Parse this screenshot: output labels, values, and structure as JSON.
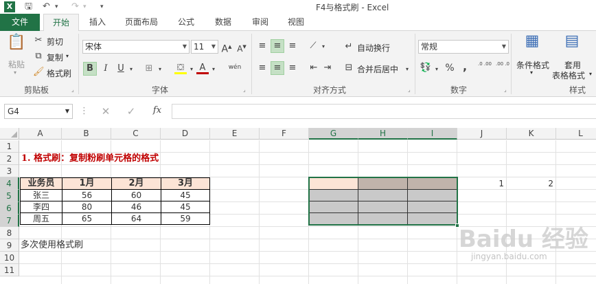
{
  "app": {
    "window_title": "F4与格式刷 - Excel",
    "logo_letter": "X"
  },
  "tabs": [
    "文件",
    "开始",
    "插入",
    "页面布局",
    "公式",
    "数据",
    "审阅",
    "视图"
  ],
  "ribbon": {
    "clipboard": {
      "paste": "粘贴",
      "cut": "剪切",
      "copy": "复制",
      "format_painter": "格式刷",
      "group": "剪贴板"
    },
    "font": {
      "name": "宋体",
      "size": "11",
      "bold": "B",
      "italic": "I",
      "underline": "U",
      "phonetic": "wén",
      "group": "字体"
    },
    "alignment": {
      "wrap": "自动换行",
      "merge": "合并后居中",
      "group": "对齐方式"
    },
    "number": {
      "format": "常规",
      "percent": "%",
      "comma": ",",
      "inc_dec": ".0 .00",
      "dec_dec": ".00 .0",
      "group": "数字"
    },
    "styles": {
      "conditional": "条件格式",
      "table_1": "套用",
      "table_2": "表格格式",
      "group": "样式"
    }
  },
  "formula_bar": {
    "name_box": "G4",
    "fx": "fx",
    "value": ""
  },
  "columns": [
    "A",
    "B",
    "C",
    "D",
    "E",
    "F",
    "G",
    "H",
    "I",
    "J",
    "K",
    "L"
  ],
  "rows": [
    "1",
    "2",
    "3",
    "4",
    "5",
    "6",
    "7",
    "8",
    "9",
    "10",
    "11"
  ],
  "cells": {
    "A2": "1. 格式刷：复制粉刷单元格的格式",
    "A9": "多次使用格式刷",
    "J4": "1",
    "K4": "2"
  },
  "table": {
    "headers": [
      "业务员",
      "1月",
      "2月",
      "3月"
    ],
    "rows": [
      [
        "张三",
        "56",
        "60",
        "45"
      ],
      [
        "李四",
        "80",
        "46",
        "45"
      ],
      [
        "周五",
        "65",
        "64",
        "59"
      ]
    ]
  },
  "colors": {
    "accent": "#217346",
    "title_red": "#c00000",
    "header_fill": "#fce4d6",
    "selection_fill": "#c9c9c9"
  },
  "watermark": {
    "brand": "Baidu 经验",
    "url": "jingyan.baidu.com"
  }
}
